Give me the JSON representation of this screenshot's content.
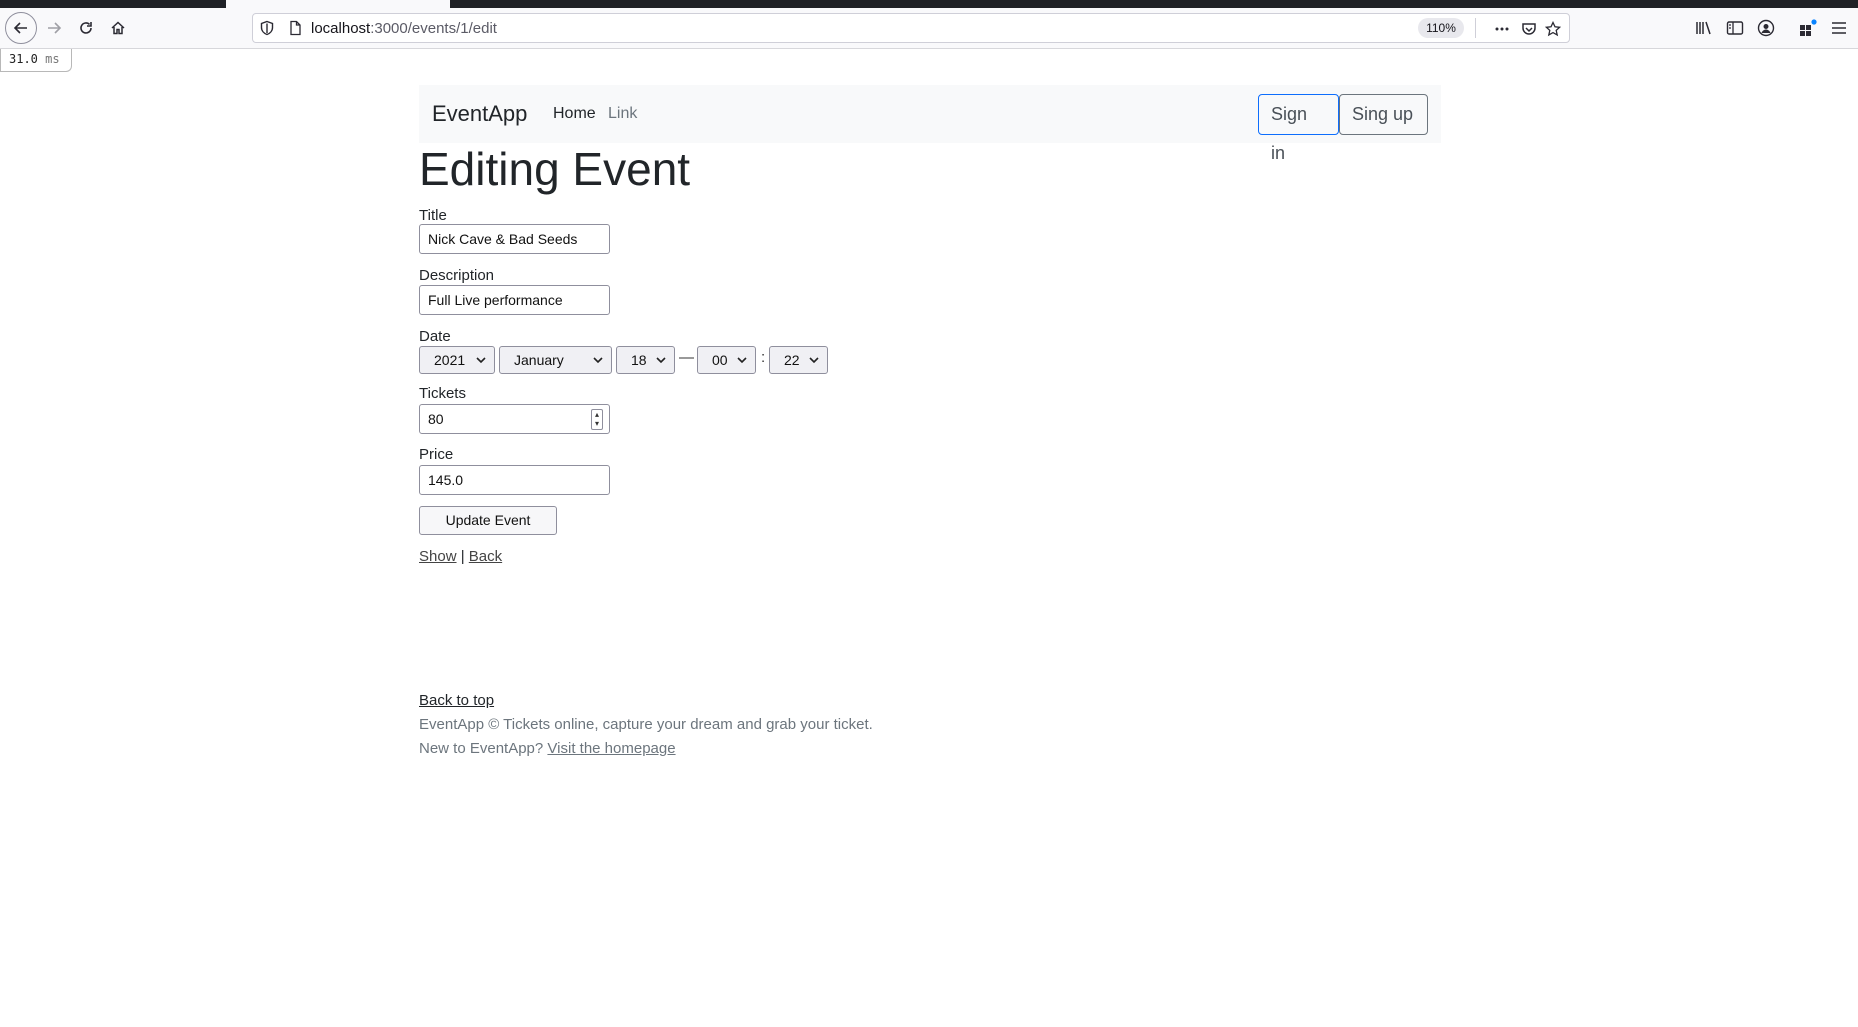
{
  "browser": {
    "url_host": "localhost",
    "url_path": ":3000/events/1/edit",
    "zoom": "110%",
    "timing_value": "31.0",
    "timing_unit": "ms"
  },
  "navbar": {
    "brand": "EventApp",
    "home": "Home",
    "link": "Link",
    "sign_in": "Sign in",
    "sign_up": "Sing up"
  },
  "page": {
    "title": "Editing Event"
  },
  "form": {
    "title_label": "Title",
    "title_value": "Nick Cave & Bad Seeds",
    "description_label": "Description",
    "description_value": "Full Live performance",
    "date_label": "Date",
    "date_year": "2021",
    "date_month": "January",
    "date_day": "18",
    "date_separator": "—",
    "date_hour": "00",
    "time_separator": ":",
    "date_minute": "22",
    "tickets_label": "Tickets",
    "tickets_value": "80",
    "price_label": "Price",
    "price_value": "145.0",
    "submit": "Update Event"
  },
  "links": {
    "show": "Show",
    "divider": "|",
    "back": "Back"
  },
  "footer": {
    "back_to_top": "Back to top",
    "tagline": "EventApp © Tickets online, capture your dream and grab your ticket.",
    "new_prefix": "New to EventApp?",
    "visit": "Visit the homepage"
  }
}
